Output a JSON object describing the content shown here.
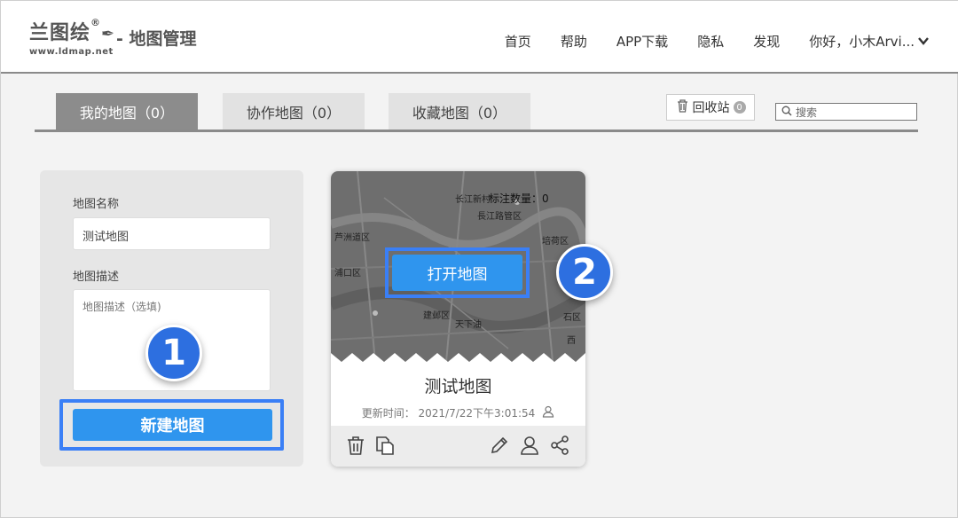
{
  "header": {
    "logo_text": "兰图绘",
    "logo_reg": "®",
    "logo_url": "www.ldmap.net",
    "title": "- 地图管理",
    "nav": [
      "首页",
      "帮助",
      "APP下载",
      "隐私",
      "发现"
    ],
    "user": "你好，小木Arvi..."
  },
  "tabs": {
    "items": [
      "我的地图（0）",
      "协作地图（0）",
      "收藏地图（0）"
    ],
    "active_index": 0,
    "recycle_label": "回收站",
    "recycle_count": "0",
    "search_placeholder": "搜索"
  },
  "form": {
    "name_label": "地图名称",
    "name_value": "测试地图",
    "desc_label": "地图描述",
    "desc_placeholder": "地图描述（选填)",
    "create_label": "新建地图"
  },
  "callouts": [
    "1",
    "2"
  ],
  "card": {
    "mark_count": "标注数量：0",
    "open_label": "打开地图",
    "title": "测试地图",
    "updated": "更新时间： 2021/7/22下午3:01:54",
    "map_labels": [
      "长江新村",
      "長江路管区",
      "培荷区",
      "芦洲道区",
      "浦口区",
      "建邺区",
      "天下油",
      "石区",
      "西"
    ]
  },
  "colors": {
    "accent": "#2f95ee",
    "highlight": "#3a7ff6",
    "callout": "#2d6fe0",
    "tab_active": "#8c8c8c"
  },
  "icons": [
    "trash-icon",
    "copy-icon",
    "edit-icon",
    "user-icon",
    "share-icon",
    "search-icon",
    "chevron-down-icon"
  ]
}
